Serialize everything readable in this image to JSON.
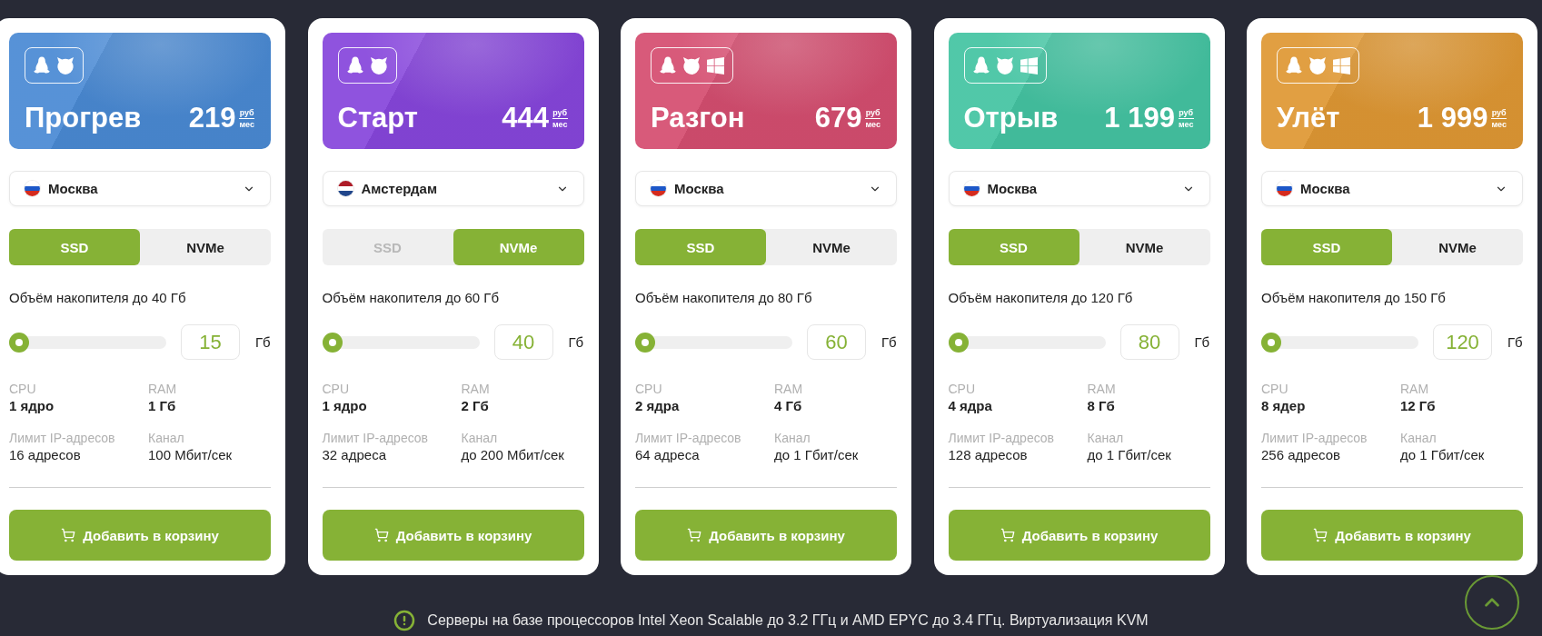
{
  "plans": [
    {
      "name": "Прогрев",
      "price": "219",
      "currency": "руб",
      "period": "мес",
      "color": "#4a8ad4",
      "os": [
        {
          "kind": "linux"
        },
        {
          "kind": "freebsd"
        }
      ],
      "location": {
        "name": "Москва",
        "flag": {
          "kind": "ru"
        }
      },
      "storage_types": [
        {
          "label": "SSD",
          "selected": true,
          "disabled": false
        },
        {
          "label": "NVMe",
          "selected": false,
          "disabled": false
        }
      ],
      "storage_label": "Объём накопителя до 40 Гб",
      "storage": {
        "level": 0,
        "value": "15",
        "unit": "Гб"
      },
      "specs": [
        {
          "label": "CPU",
          "value": "1 ядро",
          "kind": "main"
        },
        {
          "label": "RAM",
          "value": "1 Гб",
          "kind": "main"
        },
        {
          "label": "Лимит IP-адресов",
          "value": "16 адресов",
          "kind": "extra"
        },
        {
          "label": "Канал",
          "value": "100 Мбит/сек",
          "kind": "extra"
        }
      ],
      "button": "Добавить в корзину"
    },
    {
      "name": "Старт",
      "price": "444",
      "currency": "руб",
      "period": "мес",
      "color": "#8746dc",
      "os": [
        {
          "kind": "linux"
        },
        {
          "kind": "freebsd"
        }
      ],
      "location": {
        "name": "Амстердам",
        "flag": {
          "kind": "nl"
        }
      },
      "storage_types": [
        {
          "label": "SSD",
          "selected": false,
          "disabled": true
        },
        {
          "label": "NVMe",
          "selected": true,
          "disabled": false
        }
      ],
      "storage_label": "Объём накопителя до 60 Гб",
      "storage": {
        "level": 0,
        "value": "40",
        "unit": "Гб"
      },
      "specs": [
        {
          "label": "CPU",
          "value": "1 ядро",
          "kind": "main"
        },
        {
          "label": "RAM",
          "value": "2 Гб",
          "kind": "main"
        },
        {
          "label": "Лимит IP-адресов",
          "value": "32 адреса",
          "kind": "extra"
        },
        {
          "label": "Канал",
          "value": "до 200 Мбит/сек",
          "kind": "extra"
        }
      ],
      "button": "Добавить в корзину"
    },
    {
      "name": "Разгон",
      "price": "679",
      "currency": "руб",
      "period": "мес",
      "color": "#d54e70",
      "os": [
        {
          "kind": "linux"
        },
        {
          "kind": "freebsd"
        },
        {
          "kind": "windows"
        }
      ],
      "location": {
        "name": "Москва",
        "flag": {
          "kind": "ru"
        }
      },
      "storage_types": [
        {
          "label": "SSD",
          "selected": true,
          "disabled": false
        },
        {
          "label": "NVMe",
          "selected": false,
          "disabled": false
        }
      ],
      "storage_label": "Объём накопителя до 80 Гб",
      "storage": {
        "level": 0,
        "value": "60",
        "unit": "Гб"
      },
      "specs": [
        {
          "label": "CPU",
          "value": "2 ядра",
          "kind": "main"
        },
        {
          "label": "RAM",
          "value": "4 Гб",
          "kind": "main"
        },
        {
          "label": "Лимит IP-адресов",
          "value": "64 адреса",
          "kind": "extra"
        },
        {
          "label": "Канал",
          "value": "до 1 Гбит/сек",
          "kind": "extra"
        }
      ],
      "button": "Добавить в корзину"
    },
    {
      "name": "Отрыв",
      "price": "1 199",
      "currency": "руб",
      "period": "мес",
      "color": "#44c4a2",
      "os": [
        {
          "kind": "linux"
        },
        {
          "kind": "freebsd"
        },
        {
          "kind": "windows"
        }
      ],
      "location": {
        "name": "Москва",
        "flag": {
          "kind": "ru"
        }
      },
      "storage_types": [
        {
          "label": "SSD",
          "selected": true,
          "disabled": false
        },
        {
          "label": "NVMe",
          "selected": false,
          "disabled": false
        }
      ],
      "storage_label": "Объём накопителя до 120 Гб",
      "storage": {
        "level": 0,
        "value": "80",
        "unit": "Гб"
      },
      "specs": [
        {
          "label": "CPU",
          "value": "4 ядра",
          "kind": "main"
        },
        {
          "label": "RAM",
          "value": "8 Гб",
          "kind": "main"
        },
        {
          "label": "Лимит IP-адресов",
          "value": "128 адресов",
          "kind": "extra"
        },
        {
          "label": "Канал",
          "value": "до 1 Гбит/сек",
          "kind": "extra"
        }
      ],
      "button": "Добавить в корзину"
    },
    {
      "name": "Улёт",
      "price": "1 999",
      "currency": "руб",
      "period": "мес",
      "color": "#df9834",
      "os": [
        {
          "kind": "linux"
        },
        {
          "kind": "freebsd"
        },
        {
          "kind": "windows"
        }
      ],
      "location": {
        "name": "Москва",
        "flag": {
          "kind": "ru"
        }
      },
      "storage_types": [
        {
          "label": "SSD",
          "selected": true,
          "disabled": false
        },
        {
          "label": "NVMe",
          "selected": false,
          "disabled": false
        }
      ],
      "storage_label": "Объём накопителя до 150 Гб",
      "storage": {
        "level": 0,
        "value": "120",
        "unit": "Гб"
      },
      "specs": [
        {
          "label": "CPU",
          "value": "8 ядер",
          "kind": "main"
        },
        {
          "label": "RAM",
          "value": "12 Гб",
          "kind": "main"
        },
        {
          "label": "Лимит IP-адресов",
          "value": "256 адресов",
          "kind": "extra"
        },
        {
          "label": "Канал",
          "value": "до 1 Гбит/сек",
          "kind": "extra"
        }
      ],
      "button": "Добавить в корзину"
    }
  ],
  "footer": {
    "note": "Серверы на базе процессоров Intel Xeon Scalable до 3.2 ГГц и AMD EPYC до 3.4 ГГц. Виртуализация KVM"
  }
}
